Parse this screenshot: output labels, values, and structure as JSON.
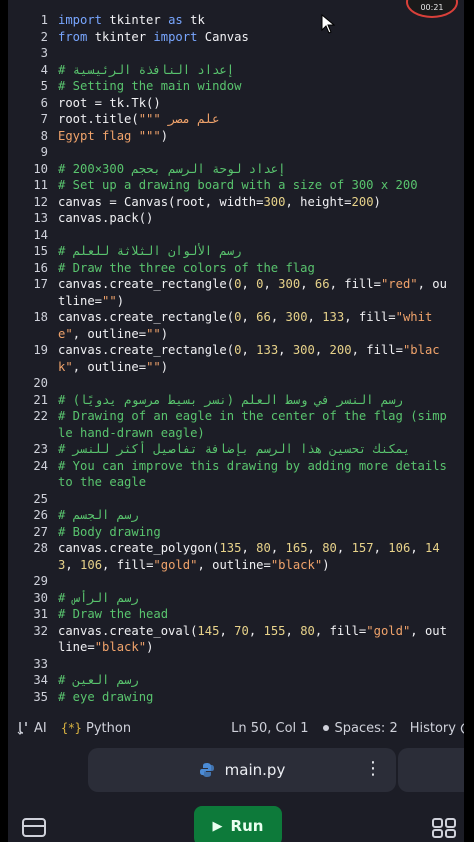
{
  "recording_badge": "00:21",
  "lines": [
    {
      "n": "1",
      "tokens": [
        {
          "t": "import",
          "c": "kw"
        },
        {
          "t": " tkinter ",
          "c": "def"
        },
        {
          "t": "as",
          "c": "kw"
        },
        {
          "t": " tk",
          "c": "def"
        }
      ]
    },
    {
      "n": "2",
      "tokens": [
        {
          "t": "from",
          "c": "kw"
        },
        {
          "t": " tkinter ",
          "c": "def"
        },
        {
          "t": "import",
          "c": "kw"
        },
        {
          "t": " Canvas",
          "c": "def"
        }
      ]
    },
    {
      "n": "3",
      "tokens": []
    },
    {
      "n": "4",
      "tokens": [
        {
          "t": "# إعداد النافذة الرئيسية",
          "c": "cm"
        }
      ]
    },
    {
      "n": "5",
      "tokens": [
        {
          "t": "# Setting the main window",
          "c": "cm"
        }
      ]
    },
    {
      "n": "6",
      "tokens": [
        {
          "t": "root = tk.Tk()",
          "c": "def"
        }
      ]
    },
    {
      "n": "7",
      "tokens": [
        {
          "t": "root.title(",
          "c": "def"
        },
        {
          "t": "\"\"\" علم مصر",
          "c": "str"
        }
      ]
    },
    {
      "n": "8",
      "tokens": [
        {
          "t": "Egypt flag \"\"\"",
          "c": "str"
        },
        {
          "t": ")",
          "c": "def"
        }
      ]
    },
    {
      "n": "9",
      "tokens": []
    },
    {
      "n": "10",
      "tokens": [
        {
          "t": "# إعداد لوحة الرسم بحجم 300×200",
          "c": "cm"
        }
      ]
    },
    {
      "n": "11",
      "tokens": [
        {
          "t": "# Set up a drawing board with a size of 300 x 200",
          "c": "cm"
        }
      ]
    },
    {
      "n": "12",
      "tokens": [
        {
          "t": "canvas = Canvas(root, width=",
          "c": "def"
        },
        {
          "t": "300",
          "c": "num"
        },
        {
          "t": ", height=",
          "c": "def"
        },
        {
          "t": "200",
          "c": "num"
        },
        {
          "t": ")",
          "c": "def"
        }
      ]
    },
    {
      "n": "13",
      "tokens": [
        {
          "t": "canvas.pack()",
          "c": "def"
        }
      ]
    },
    {
      "n": "14",
      "tokens": []
    },
    {
      "n": "15",
      "tokens": [
        {
          "t": "# رسم الألوان الثلاثة للعلم",
          "c": "cm"
        }
      ]
    },
    {
      "n": "16",
      "tokens": [
        {
          "t": "# Draw the three colors of the flag",
          "c": "cm"
        }
      ]
    },
    {
      "n": "17",
      "tokens": [
        {
          "t": "canvas.create_rectangle(",
          "c": "def"
        },
        {
          "t": "0",
          "c": "num"
        },
        {
          "t": ", ",
          "c": "def"
        },
        {
          "t": "0",
          "c": "num"
        },
        {
          "t": ", ",
          "c": "def"
        },
        {
          "t": "300",
          "c": "num"
        },
        {
          "t": ", ",
          "c": "def"
        },
        {
          "t": "66",
          "c": "num"
        },
        {
          "t": ", fill=",
          "c": "def"
        },
        {
          "t": "\"red\"",
          "c": "str"
        },
        {
          "t": ", outline=",
          "c": "def"
        },
        {
          "t": "\"\"",
          "c": "str"
        },
        {
          "t": ")",
          "c": "def"
        }
      ]
    },
    {
      "n": "18",
      "tokens": [
        {
          "t": "canvas.create_rectangle(",
          "c": "def"
        },
        {
          "t": "0",
          "c": "num"
        },
        {
          "t": ", ",
          "c": "def"
        },
        {
          "t": "66",
          "c": "num"
        },
        {
          "t": ", ",
          "c": "def"
        },
        {
          "t": "300",
          "c": "num"
        },
        {
          "t": ", ",
          "c": "def"
        },
        {
          "t": "133",
          "c": "num"
        },
        {
          "t": ", fill=",
          "c": "def"
        },
        {
          "t": "\"white\"",
          "c": "str"
        },
        {
          "t": ", outline=",
          "c": "def"
        },
        {
          "t": "\"\"",
          "c": "str"
        },
        {
          "t": ")",
          "c": "def"
        }
      ]
    },
    {
      "n": "19",
      "tokens": [
        {
          "t": "canvas.create_rectangle(",
          "c": "def"
        },
        {
          "t": "0",
          "c": "num"
        },
        {
          "t": ", ",
          "c": "def"
        },
        {
          "t": "133",
          "c": "num"
        },
        {
          "t": ", ",
          "c": "def"
        },
        {
          "t": "300",
          "c": "num"
        },
        {
          "t": ", ",
          "c": "def"
        },
        {
          "t": "200",
          "c": "num"
        },
        {
          "t": ", fill=",
          "c": "def"
        },
        {
          "t": "\"black\"",
          "c": "str"
        },
        {
          "t": ", outline=",
          "c": "def"
        },
        {
          "t": "\"\"",
          "c": "str"
        },
        {
          "t": ")",
          "c": "def"
        }
      ]
    },
    {
      "n": "20",
      "tokens": []
    },
    {
      "n": "21",
      "tokens": [
        {
          "t": "# رسم النسر في وسط العلم (نسر بسيط مرسوم يدويًا)",
          "c": "cm"
        }
      ]
    },
    {
      "n": "22",
      "tokens": [
        {
          "t": "# Drawing of an eagle in the center of the flag (simple hand-drawn eagle)",
          "c": "cm"
        }
      ]
    },
    {
      "n": "23",
      "tokens": [
        {
          "t": "# يمكنك تحسين هذا الرسم بإضافة تفاصيل أكثر للنسر",
          "c": "cm"
        }
      ]
    },
    {
      "n": "24",
      "tokens": [
        {
          "t": "# You can improve this drawing by adding more details to the eagle",
          "c": "cm"
        }
      ]
    },
    {
      "n": "25",
      "tokens": []
    },
    {
      "n": "26",
      "tokens": [
        {
          "t": "# رسم الجسم",
          "c": "cm"
        }
      ]
    },
    {
      "n": "27",
      "tokens": [
        {
          "t": "# Body drawing",
          "c": "cm"
        }
      ]
    },
    {
      "n": "28",
      "tokens": [
        {
          "t": "canvas.create_polygon(",
          "c": "def"
        },
        {
          "t": "135",
          "c": "num"
        },
        {
          "t": ", ",
          "c": "def"
        },
        {
          "t": "80",
          "c": "num"
        },
        {
          "t": ", ",
          "c": "def"
        },
        {
          "t": "165",
          "c": "num"
        },
        {
          "t": ", ",
          "c": "def"
        },
        {
          "t": "80",
          "c": "num"
        },
        {
          "t": ", ",
          "c": "def"
        },
        {
          "t": "157",
          "c": "num"
        },
        {
          "t": ", ",
          "c": "def"
        },
        {
          "t": "106",
          "c": "num"
        },
        {
          "t": ", ",
          "c": "def"
        },
        {
          "t": "143",
          "c": "num"
        },
        {
          "t": ", ",
          "c": "def"
        },
        {
          "t": "106",
          "c": "num"
        },
        {
          "t": ", fill=",
          "c": "def"
        },
        {
          "t": "\"gold\"",
          "c": "str"
        },
        {
          "t": ", outline=",
          "c": "def"
        },
        {
          "t": "\"black\"",
          "c": "str"
        },
        {
          "t": ")",
          "c": "def"
        }
      ]
    },
    {
      "n": "29",
      "tokens": []
    },
    {
      "n": "30",
      "tokens": [
        {
          "t": "# رسم الرأس",
          "c": "cm"
        }
      ]
    },
    {
      "n": "31",
      "tokens": [
        {
          "t": "# Draw the head",
          "c": "cm"
        }
      ]
    },
    {
      "n": "32",
      "tokens": [
        {
          "t": "canvas.create_oval(",
          "c": "def"
        },
        {
          "t": "145",
          "c": "num"
        },
        {
          "t": ", ",
          "c": "def"
        },
        {
          "t": "70",
          "c": "num"
        },
        {
          "t": ", ",
          "c": "def"
        },
        {
          "t": "155",
          "c": "num"
        },
        {
          "t": ", ",
          "c": "def"
        },
        {
          "t": "80",
          "c": "num"
        },
        {
          "t": ", fill=",
          "c": "def"
        },
        {
          "t": "\"gold\"",
          "c": "str"
        },
        {
          "t": ", outline=",
          "c": "def"
        },
        {
          "t": "\"black\"",
          "c": "str"
        },
        {
          "t": ")",
          "c": "def"
        }
      ]
    },
    {
      "n": "33",
      "tokens": []
    },
    {
      "n": "34",
      "tokens": [
        {
          "t": "# رسم العين",
          "c": "cm"
        }
      ]
    },
    {
      "n": "35",
      "tokens": [
        {
          "t": "# eye drawing",
          "c": "cm"
        }
      ]
    }
  ],
  "status": {
    "ai": "AI",
    "language": "Python",
    "position": "Ln 50, Col 1",
    "spaces": "Spaces: 2",
    "history": "History"
  },
  "tab": {
    "filename": "main.py"
  },
  "run_label": "Run",
  "colors": {
    "keyword": "#78a6ff",
    "comment": "#59c46e",
    "string": "#f0a36b",
    "number": "#e7d28a",
    "background": "#1c1d26",
    "run": "#0d7a3a"
  }
}
